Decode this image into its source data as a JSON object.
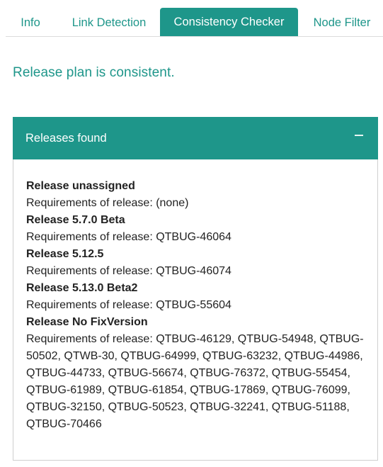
{
  "tabs": [
    {
      "label": "Info"
    },
    {
      "label": "Link Detection"
    },
    {
      "label": "Consistency Checker",
      "active": true
    },
    {
      "label": "Node Filter"
    }
  ],
  "status_message": "Release plan is consistent.",
  "panel": {
    "title": "Releases found",
    "collapse_icon": "minus-icon"
  },
  "releases": [
    {
      "name": "Release unassigned",
      "requirements": "Requirements of release: (none)"
    },
    {
      "name": "Release 5.7.0 Beta",
      "requirements": "Requirements of release: QTBUG-46064"
    },
    {
      "name": "Release 5.12.5",
      "requirements": "Requirements of release: QTBUG-46074"
    },
    {
      "name": "Release 5.13.0 Beta2",
      "requirements": "Requirements of release: QTBUG-55604"
    },
    {
      "name": "Release No FixVersion",
      "requirements": "Requirements of release: QTBUG-46129, QTBUG-54948, QTBUG-50502, QTWB-30, QTBUG-64999, QTBUG-63232, QTBUG-44986, QTBUG-44733, QTBUG-56674, QTBUG-76372, QTBUG-55454, QTBUG-61989, QTBUG-61854, QTBUG-17869, QTBUG-76099, QTBUG-32150, QTBUG-50523, QTBUG-32241, QTBUG-51188, QTBUG-70466"
    }
  ],
  "colors": {
    "accent": "#1e968a",
    "border": "#cfcfcf"
  }
}
